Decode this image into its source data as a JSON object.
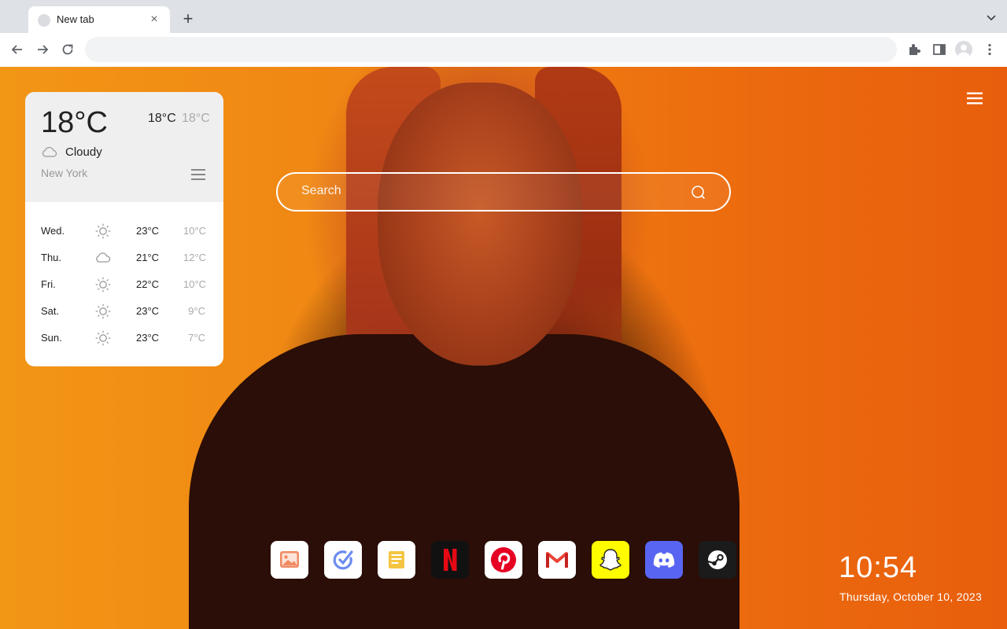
{
  "browser": {
    "tab_title": "New tab",
    "new_tab_symbol": "+",
    "close_symbol": "×"
  },
  "weather": {
    "current_temp": "18°C",
    "high": "18°C",
    "low": "18°C",
    "condition": "Cloudy",
    "condition_icon": "cloud-icon",
    "city": "New York",
    "forecast": [
      {
        "day": "Wed.",
        "icon": "sun-icon",
        "high": "23°C",
        "low": "10°C"
      },
      {
        "day": "Thu.",
        "icon": "cloud-icon",
        "high": "21°C",
        "low": "12°C"
      },
      {
        "day": "Fri.",
        "icon": "sun-icon",
        "high": "22°C",
        "low": "10°C"
      },
      {
        "day": "Sat.",
        "icon": "sun-icon",
        "high": "23°C",
        "low": "9°C"
      },
      {
        "day": "Sun.",
        "icon": "sun-icon",
        "high": "23°C",
        "low": "7°C"
      }
    ]
  },
  "search": {
    "placeholder": "Search"
  },
  "dock": [
    {
      "name": "photos-app",
      "icon": "image-icon",
      "bg": "#ffffff"
    },
    {
      "name": "todo-app",
      "icon": "check-circle-icon",
      "bg": "#ffffff"
    },
    {
      "name": "notes-app",
      "icon": "note-icon",
      "bg": "#ffffff"
    },
    {
      "name": "netflix",
      "icon": "netflix-icon",
      "bg": "#111111"
    },
    {
      "name": "pinterest",
      "icon": "pinterest-icon",
      "bg": "#ffffff"
    },
    {
      "name": "gmail",
      "icon": "gmail-icon",
      "bg": "#ffffff"
    },
    {
      "name": "snapchat",
      "icon": "snapchat-icon",
      "bg": "#fffc00"
    },
    {
      "name": "discord",
      "icon": "discord-icon",
      "bg": "#5865f2"
    },
    {
      "name": "steam",
      "icon": "steam-icon",
      "bg": "#1b1b1b"
    }
  ],
  "clock": {
    "time": "10:54",
    "date": "Thursday, October 10, 2023"
  }
}
